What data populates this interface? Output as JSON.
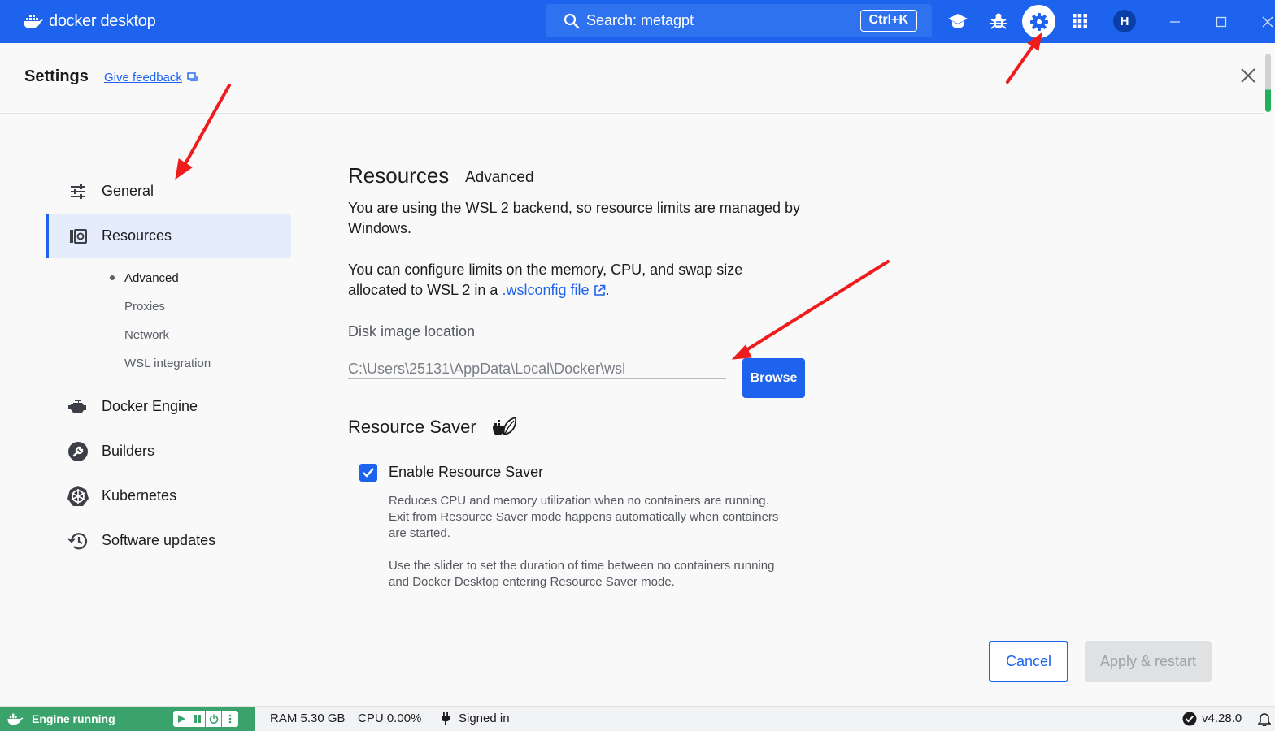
{
  "titlebar": {
    "app_name": "docker desktop",
    "search_text": "Search: metagpt",
    "search_shortcut": "Ctrl+K",
    "avatar_initial": "H",
    "brand_color": "#1d63ed",
    "icons": [
      "learning-center-icon",
      "bug-icon",
      "gear-icon",
      "extensions-grid-icon",
      "minimize-icon",
      "maximize-icon",
      "close-icon"
    ]
  },
  "header": {
    "title": "Settings",
    "feedback_link": "Give feedback"
  },
  "sidebar": {
    "items": [
      {
        "label": "General",
        "icon": "sliders-icon"
      },
      {
        "label": "Resources",
        "icon": "resources-icon",
        "active": true
      },
      {
        "label": "Docker Engine",
        "icon": "engine-icon"
      },
      {
        "label": "Builders",
        "icon": "wrench-icon"
      },
      {
        "label": "Kubernetes",
        "icon": "helm-icon"
      },
      {
        "label": "Software updates",
        "icon": "history-icon"
      }
    ],
    "subitems": [
      "Advanced",
      "Proxies",
      "Network",
      "WSL integration"
    ],
    "active_subitem": "Advanced"
  },
  "main": {
    "title": "Resources",
    "subtitle": "Advanced",
    "wsl_note_line1": "You are using the WSL 2 backend, so resource limits are managed by",
    "wsl_note_line2": "Windows.",
    "config_line1": "You can configure limits on the memory, CPU, and swap size",
    "config_line2_prefix": "allocated to WSL 2 in a ",
    "config_link": ".wslconfig file",
    "config_line2_suffix": ".",
    "disk_label": "Disk image location",
    "disk_path": "C:\\Users\\25131\\AppData\\Local\\Docker\\wsl",
    "browse_label": "Browse",
    "saver_title": "Resource Saver",
    "saver_checkbox_label": "Enable Resource Saver",
    "saver_checked": true,
    "saver_desc1_line1": "Reduces CPU and memory utilization when no containers are running.",
    "saver_desc1_line2": "Exit from Resource Saver mode happens automatically when containers",
    "saver_desc1_line3": "are started.",
    "saver_desc2_line1": "Use the slider to set the duration of time between no containers running",
    "saver_desc2_line2": "and Docker Desktop entering Resource Saver mode."
  },
  "footer": {
    "cancel_label": "Cancel",
    "apply_label": "Apply & restart"
  },
  "statusbar": {
    "engine_status": "Engine running",
    "engine_color": "#3aa36b",
    "ram": "RAM 5.30 GB",
    "cpu": "CPU 0.00%",
    "signed_in": "Signed in",
    "version": "v4.28.0"
  }
}
